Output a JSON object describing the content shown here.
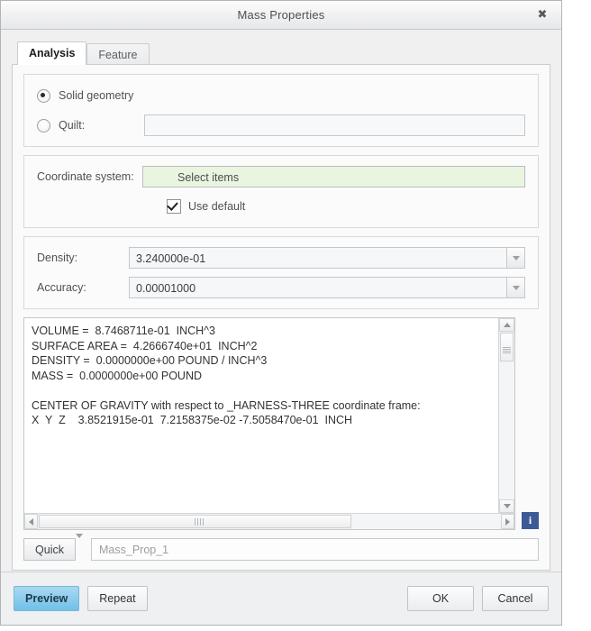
{
  "window": {
    "title": "Mass Properties",
    "close_label": "✖"
  },
  "tabs": [
    {
      "label": "Analysis",
      "active": true
    },
    {
      "label": "Feature",
      "active": false
    }
  ],
  "geometry_group": {
    "solid_radio_label": "Solid geometry",
    "solid_radio_checked": true,
    "quilt_radio_label": "Quilt:",
    "quilt_radio_checked": false,
    "quilt_value": ""
  },
  "coordinate_group": {
    "label": "Coordinate system:",
    "select_value": "Select items",
    "select_bg": "#e9f5df",
    "use_default_label": "Use default",
    "use_default_checked": true
  },
  "parameters_group": {
    "density_label": "Density:",
    "density_value": "3.240000e-01",
    "accuracy_label": "Accuracy:",
    "accuracy_value": "0.00001000"
  },
  "results": {
    "text": "VOLUME =  8.7468711e-01  INCH^3\nSURFACE AREA =  4.2666740e+01  INCH^2\nDENSITY =  0.0000000e+00 POUND / INCH^3\nMASS =  0.0000000e+00 POUND\n\nCENTER OF GRAVITY with respect to _HARNESS-THREE coordinate frame:\nX  Y  Z    3.8521915e-01  7.2158375e-02 -7.5058470e-01  INCH",
    "lines": [
      "VOLUME =  8.7468711e-01  INCH^3",
      "SURFACE AREA =  4.2666740e+01  INCH^2",
      "DENSITY =  0.0000000e+00 POUND / INCH^3",
      "MASS =  0.0000000e+00 POUND",
      "",
      "CENTER OF GRAVITY with respect to _HARNESS-THREE coordinate frame:",
      "X  Y  Z    3.8521915e-01  7.2158375e-02 -7.5058470e-01  INCH"
    ],
    "info_button_label": "i",
    "info_button_color": "#3c5a96"
  },
  "name_row": {
    "quick_label": "Quick",
    "name_value": "Mass_Prop_1"
  },
  "footer": {
    "preview_label": "Preview",
    "repeat_label": "Repeat",
    "ok_label": "OK",
    "cancel_label": "Cancel",
    "preview_accent": "#71c0e8"
  }
}
